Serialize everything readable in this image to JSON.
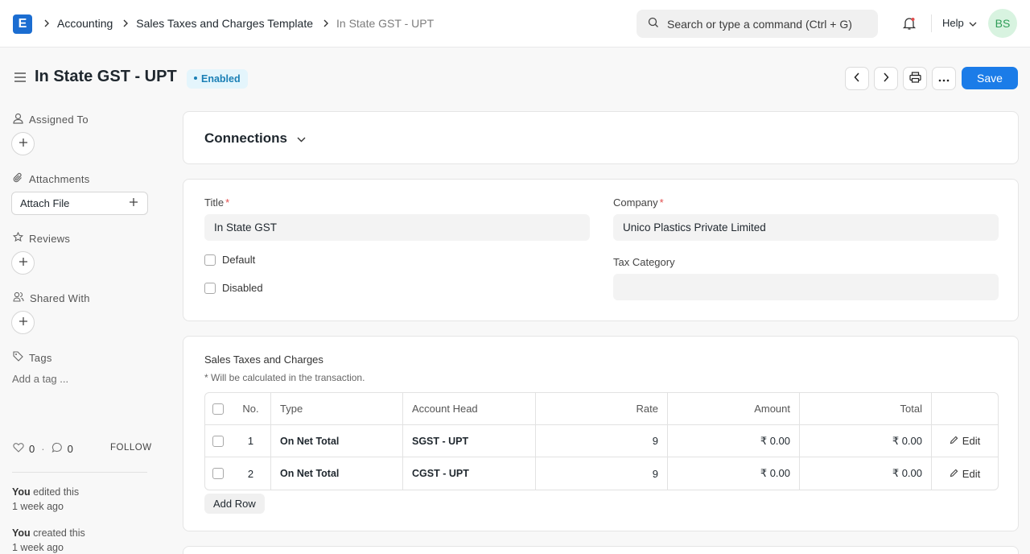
{
  "navbar": {
    "logo": "E",
    "breadcrumbs": [
      "Accounting",
      "Sales Taxes and Charges Template",
      "In State GST - UPT"
    ],
    "search_placeholder": "Search or type a command (Ctrl + G)",
    "help_label": "Help",
    "avatar_initials": "BS"
  },
  "page": {
    "title": "In State GST - UPT",
    "status": "Enabled",
    "save_label": "Save"
  },
  "sidebar": {
    "assigned_to": "Assigned To",
    "attachments": "Attachments",
    "attach_file": "Attach File",
    "reviews": "Reviews",
    "shared_with": "Shared With",
    "tags": "Tags",
    "add_tag": "Add a tag ...",
    "likes_count": "0",
    "comments_count": "0",
    "follow_label": "FOLLOW",
    "activity": [
      {
        "user": "You",
        "action": "edited this",
        "time": "1 week ago"
      },
      {
        "user": "You",
        "action": "created this",
        "time": "1 week ago"
      }
    ]
  },
  "connections": {
    "title": "Connections"
  },
  "form": {
    "title_label": "Title",
    "title_value": "In State GST",
    "default_label": "Default",
    "disabled_label": "Disabled",
    "company_label": "Company",
    "company_value": "Unico Plastics Private Limited",
    "tax_category_label": "Tax Category",
    "tax_category_value": ""
  },
  "taxes": {
    "title": "Sales Taxes and Charges",
    "note": "* Will be calculated in the transaction.",
    "columns": [
      "No.",
      "Type",
      "Account Head",
      "Rate",
      "Amount",
      "Total"
    ],
    "rows": [
      {
        "no": "1",
        "type": "On Net Total",
        "account": "SGST - UPT",
        "rate": "9",
        "amount": "₹ 0.00",
        "total": "₹ 0.00",
        "edit": "Edit"
      },
      {
        "no": "2",
        "type": "On Net Total",
        "account": "CGST - UPT",
        "rate": "9",
        "amount": "₹ 0.00",
        "total": "₹ 0.00",
        "edit": "Edit"
      }
    ],
    "add_row_label": "Add Row"
  },
  "colors": {
    "primary": "#1b7ce8",
    "logo": "#1b6dd1",
    "badge_bg": "#e4f5fc",
    "badge_text": "#1a7fb5"
  }
}
